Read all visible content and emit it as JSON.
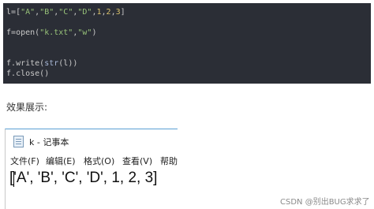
{
  "code": {
    "line1": {
      "var": "l",
      "eq": "=",
      "open": "[",
      "s1": "\"A\"",
      "c1": ",",
      "s2": "\"B\"",
      "c2": ",",
      "s3": "\"C\"",
      "c3": ",",
      "s4": "\"D\"",
      "c4": ",",
      "n1": "1",
      "c5": ",",
      "n2": "2",
      "c6": ",",
      "n3": "3",
      "close": "]"
    },
    "line3": {
      "var": "f",
      "eq": "=",
      "fn": "open",
      "lp": "(",
      "s1": "\"k.txt\"",
      "comma": ",",
      "s2": "\"w\"",
      "rp": ")"
    },
    "line5": {
      "obj": "f",
      "dot": ".",
      "fn": "write",
      "lp": "(",
      "builtin": "str",
      "lp2": "(",
      "arg": "l",
      "rp2": ")",
      "rp": ")"
    },
    "line6": {
      "obj": "f",
      "dot": ".",
      "fn": "close",
      "parens": "()"
    }
  },
  "caption": "效果展示:",
  "notepad": {
    "title": "k - 记事本",
    "menu": [
      "文件(F)",
      "编辑(E)",
      "格式(O)",
      "查看(V)",
      "帮助"
    ],
    "content": "['A', 'B', 'C', 'D', 1, 2, 3]"
  },
  "watermark": "CSDN @别出BUG求求了"
}
